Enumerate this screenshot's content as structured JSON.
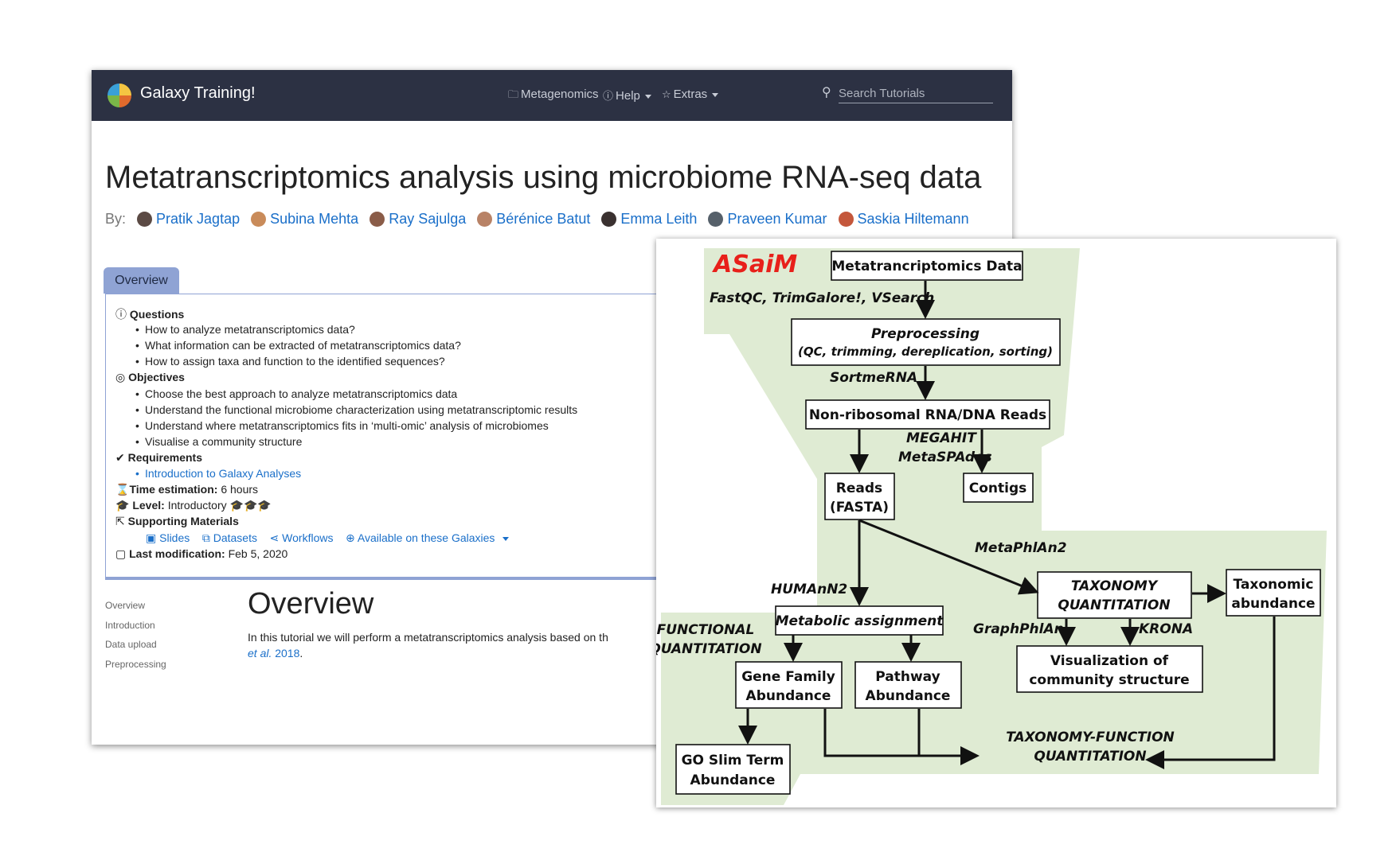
{
  "navbar": {
    "brand": "Galaxy Training!",
    "items": [
      {
        "icon": "folder-icon",
        "label": "Metagenomics"
      },
      {
        "icon": "help-icon",
        "label": "Help"
      },
      {
        "icon": "star-icon",
        "label": "Extras"
      }
    ],
    "search_placeholder": "Search Tutorials"
  },
  "tutorial": {
    "title": "Metatranscriptomics analysis using microbiome RNA-seq data",
    "by_label": "By:",
    "authors": [
      "Pratik Jagtap",
      "Subina Mehta",
      "Ray Sajulga",
      "Bérénice Batut",
      "Emma Leith",
      "Praveen Kumar",
      "Saskia Hiltemann"
    ]
  },
  "overview": {
    "tab": "Overview",
    "questions_label": "Questions",
    "questions": [
      "How to analyze metatranscriptomics data?",
      "What information can be extracted of metatranscriptomics data?",
      "How to assign taxa and function to the identified sequences?"
    ],
    "objectives_label": "Objectives",
    "objectives": [
      "Choose the best approach to analyze metatranscriptomics data",
      "Understand the functional microbiome characterization using metatranscriptomic results",
      "Understand where metatranscriptomics fits in ‘multi-omic’ analysis of microbiomes",
      "Visualise a community structure"
    ],
    "requirements_label": "Requirements",
    "requirements": [
      "Introduction to Galaxy Analyses"
    ],
    "time_label": "Time estimation:",
    "time_value": "6 hours",
    "level_label": "Level:",
    "level_value": "Introductory",
    "level_rating": {
      "filled": 1,
      "total": 3
    },
    "materials_label": "Supporting Materials",
    "materials": [
      "Slides",
      "Datasets",
      "Workflows",
      "Available on these Galaxies"
    ],
    "modified_label": "Last modification:",
    "modified_value": "Feb 5, 2020"
  },
  "toc": [
    "Overview",
    "Introduction",
    "Data upload",
    "Preprocessing"
  ],
  "content": {
    "heading": "Overview",
    "para_line1": "In this tutorial we will perform a metatranscriptomics analysis based on th",
    "para_link": "et al.",
    "para_year": " 2018",
    "para_end": "."
  },
  "diagram": {
    "title": "ASaiM",
    "title_color": "#e8201a",
    "background_color": "#dfebd3",
    "boxes": {
      "data": "Metatrancriptomics Data",
      "prep1": "Preprocessing",
      "prep2": "(QC, trimming, dereplication, sorting)",
      "nonribo": "Non-ribosomal RNA/DNA Reads",
      "reads1": "Reads",
      "reads2": "(FASTA)",
      "contigs": "Contigs",
      "metab": "Metabolic assignment",
      "tax1": "TAXONOMY",
      "tax2": "QUANTITATION",
      "taxab1": "Taxonomic",
      "taxab2": "abundance",
      "gene1": "Gene Family",
      "gene2": "Abundance",
      "path1": "Pathway",
      "path2": "Abundance",
      "vis1": "Visualization of",
      "vis2": "community structure",
      "go1": "GO Slim Term",
      "go2": "Abundance"
    },
    "labels": {
      "tools1": "FastQC, TrimGalore!,  VSearch",
      "sortme": "SortmeRNA",
      "megahit": "MEGAHIT",
      "metaspades": "MetaSPAdes",
      "metaphlan": "MetaPhlAn2",
      "humann": "HUMAnN2",
      "func1": "FUNCTIONAL",
      "func2": "QUANTITATION",
      "graphphlan": "GraphPhlAn",
      "krona": "KRONA",
      "tf1": "TAXONOMY-FUNCTION",
      "tf2": "QUANTITATION"
    }
  }
}
